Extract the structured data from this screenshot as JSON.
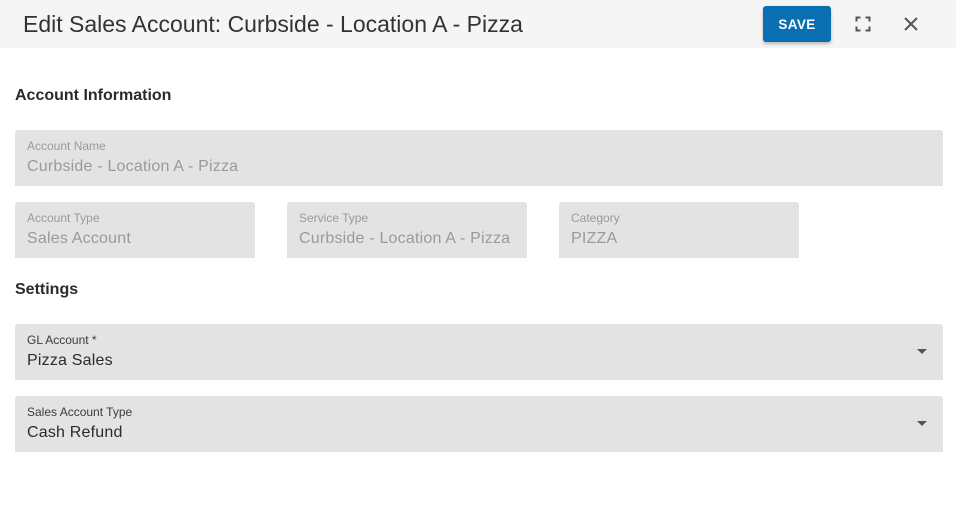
{
  "header": {
    "title": "Edit Sales Account: Curbside - Location A - Pizza",
    "save_label": "SAVE",
    "fullscreen_icon": "fullscreen-icon",
    "close_icon": "close-icon"
  },
  "account_information": {
    "title": "Account Information",
    "account_name": {
      "label": "Account Name",
      "value": "Curbside - Location A - Pizza"
    },
    "account_type": {
      "label": "Account Type",
      "value": "Sales Account"
    },
    "service_type": {
      "label": "Service Type",
      "value": "Curbside - Location A - Pizza"
    },
    "category": {
      "label": "Category",
      "value": "PIZZA"
    }
  },
  "settings": {
    "title": "Settings",
    "gl_account": {
      "label": "GL Account *",
      "value": "Pizza Sales"
    },
    "sales_account_type": {
      "label": "Sales Account Type",
      "value": "Cash Refund"
    }
  },
  "colors": {
    "primary": "#0a6fb0",
    "header_bg": "#f5f5f5",
    "field_bg": "#e3e3e3",
    "disabled_text": "#9a9a9a"
  }
}
